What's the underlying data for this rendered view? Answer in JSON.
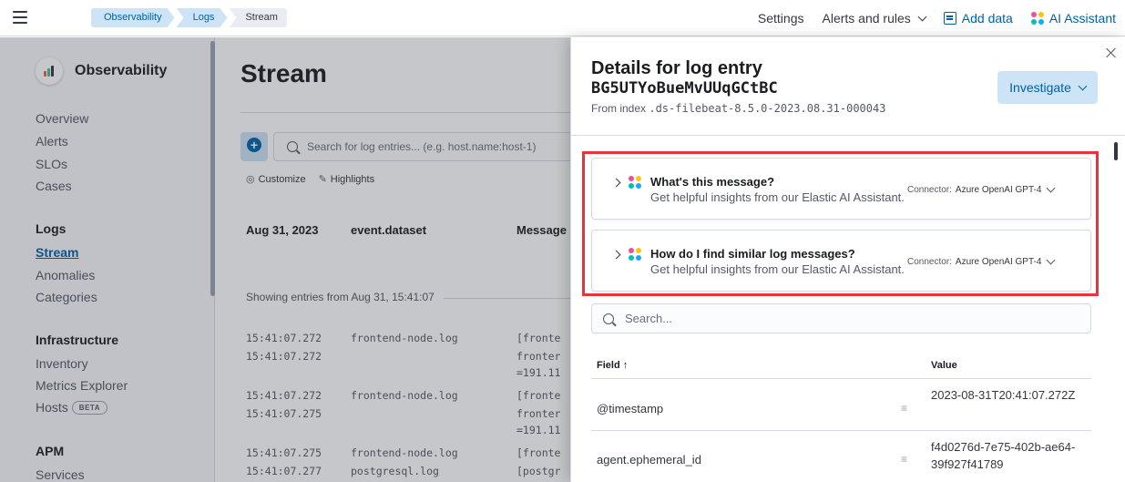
{
  "topbar": {
    "breadcrumbs": [
      "Observability",
      "Logs",
      "Stream"
    ],
    "settings_label": "Settings",
    "alerts_label": "Alerts and rules",
    "add_data_label": "Add data",
    "ai_assistant_label": "AI Assistant"
  },
  "sidebar": {
    "title": "Observability",
    "top_items": [
      "Overview",
      "Alerts",
      "SLOs",
      "Cases"
    ],
    "logs_heading": "Logs",
    "logs_items": [
      "Stream",
      "Anomalies",
      "Categories"
    ],
    "infra_heading": "Infrastructure",
    "infra_items": [
      "Inventory",
      "Metrics Explorer",
      "Hosts"
    ],
    "hosts_badge": "BETA",
    "apm_heading": "APM",
    "apm_items": [
      "Services"
    ]
  },
  "stream": {
    "title": "Stream",
    "search_placeholder": "Search for log entries... (e.g. host.name:host-1)",
    "customize_label": "Customize",
    "highlights_label": "Highlights",
    "columns": [
      "Aug 31, 2023",
      "event.dataset",
      "Message"
    ],
    "showing_text": "Showing entries from Aug 31, 15:41:07",
    "rows": [
      {
        "time": "15:41:07.272",
        "dataset": "frontend-node.log",
        "message": "[fronte"
      },
      {
        "time": "15:41:07.272",
        "dataset": "",
        "message": "fronter"
      },
      {
        "time": "",
        "dataset": "",
        "message": "=191.11"
      },
      {
        "time": "15:41:07.272",
        "dataset": "frontend-node.log",
        "message": "[fronte"
      },
      {
        "time": "15:41:07.275",
        "dataset": "",
        "message": "fronter"
      },
      {
        "time": "",
        "dataset": "",
        "message": "=191.11"
      },
      {
        "time": "15:41:07.275",
        "dataset": "frontend-node.log",
        "message": "[fronte"
      },
      {
        "time": "15:41:07.277",
        "dataset": "postgresql.log",
        "message": "[postgr"
      }
    ]
  },
  "flyout": {
    "title": "Details for log entry",
    "entry_id": "BG5UTYoBueMvUUqGCtBC",
    "index_prefix": "From index ",
    "index_name": ".ds-filebeat-8.5.0-2023.08.31-000043",
    "investigate_label": "Investigate",
    "ai_prompts": [
      {
        "question": "What's this message?",
        "subtitle": "Get helpful insights from our Elastic AI Assistant.",
        "connector_label": "Connector:",
        "connector_value": "Azure OpenAI GPT-4"
      },
      {
        "question": "How do I find similar log messages?",
        "subtitle": "Get helpful insights from our Elastic AI Assistant.",
        "connector_label": "Connector:",
        "connector_value": "Azure OpenAI GPT-4"
      }
    ],
    "search_placeholder": "Search...",
    "table": {
      "field_header": "Field",
      "value_header": "Value",
      "rows": [
        {
          "field": "@timestamp",
          "value": "2023-08-31T20:41:07.272Z"
        },
        {
          "field": "agent.ephemeral_id",
          "value": "f4d0276d-7e75-402b-ae64-39f927f41789"
        }
      ]
    }
  },
  "colors": {
    "accent": "#0061a6",
    "accent_light": "#cce4f5",
    "highlight_border": "#e5343b"
  }
}
